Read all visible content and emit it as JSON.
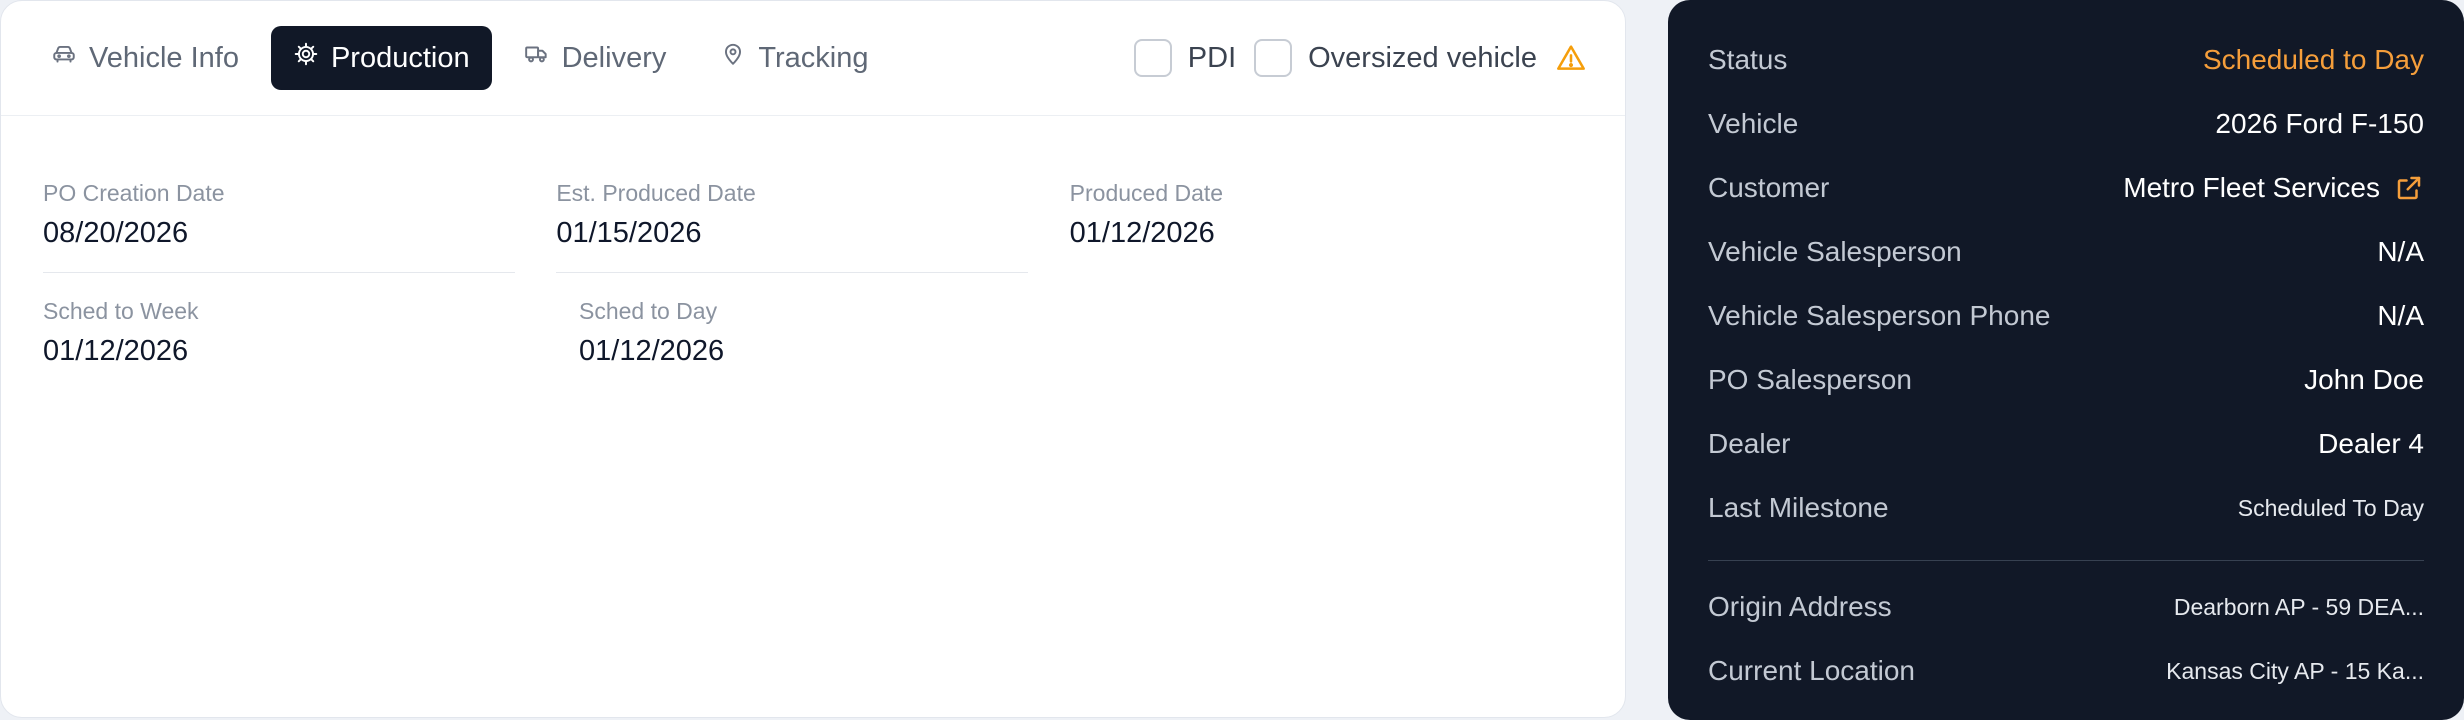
{
  "tabs": [
    {
      "label": "Vehicle Info",
      "icon": "car-icon",
      "active": false
    },
    {
      "label": "Production",
      "icon": "gear-icon",
      "active": true
    },
    {
      "label": "Delivery",
      "icon": "truck-icon",
      "active": false
    },
    {
      "label": "Tracking",
      "icon": "map-pin-icon",
      "active": false
    }
  ],
  "checks": {
    "pdi_label": "PDI",
    "oversized_label": "Oversized vehicle",
    "pdi_checked": false,
    "oversized_checked": false
  },
  "production": {
    "po_creation": {
      "label": "PO Creation Date",
      "value": "08/20/2026"
    },
    "est_produced": {
      "label": "Est. Produced Date",
      "value": "01/15/2026"
    },
    "produced": {
      "label": "Produced Date",
      "value": "01/12/2026"
    },
    "sched_week": {
      "label": "Sched to Week",
      "value": "01/12/2026"
    },
    "sched_day": {
      "label": "Sched to Day",
      "value": "01/12/2026"
    }
  },
  "summary": {
    "rows": [
      {
        "key": "Status",
        "value": "Scheduled to Day"
      },
      {
        "key": "Vehicle",
        "value": "2026 Ford F-150"
      },
      {
        "key": "Customer",
        "value": "Metro Fleet Services"
      },
      {
        "key": "Vehicle Salesperson",
        "value": "N/A"
      },
      {
        "key": "Vehicle Salesperson Phone",
        "value": "N/A"
      },
      {
        "key": "PO Salesperson",
        "value": "John Doe"
      },
      {
        "key": "Dealer",
        "value": "Dealer 4"
      },
      {
        "key": "Last Milestone",
        "value": "Scheduled To Day"
      }
    ],
    "locations": [
      {
        "key": "Origin Address",
        "value": "Dearborn AP - 59 DEA..."
      },
      {
        "key": "Current Location",
        "value": "Kansas City AP - 15 Ka..."
      }
    ]
  },
  "colors": {
    "accent": "#f59e3b",
    "panel_bg": "#111827",
    "active_tab": "#111827"
  }
}
